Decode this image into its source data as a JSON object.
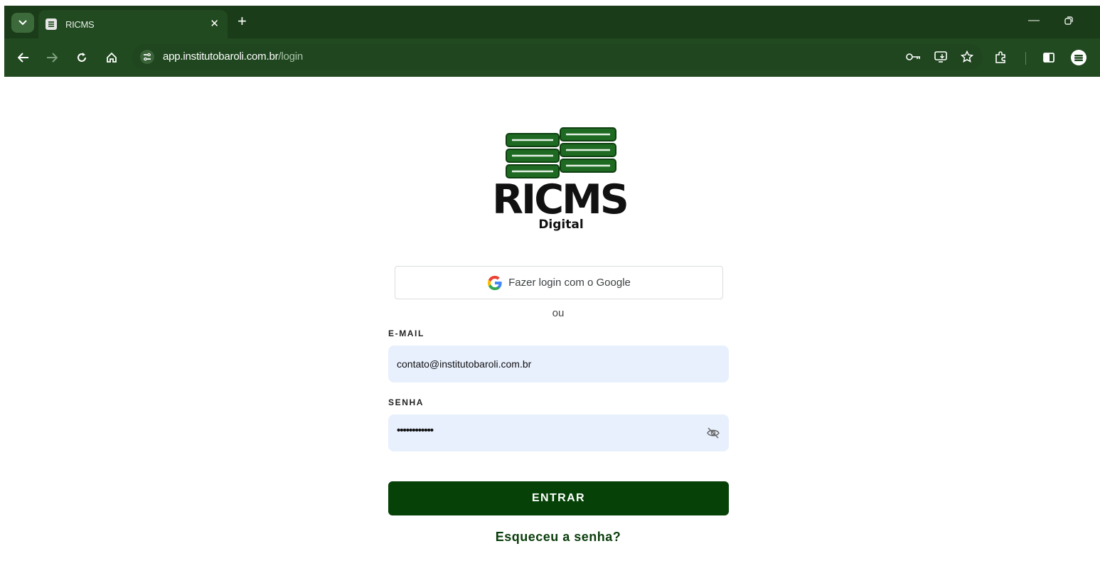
{
  "browser": {
    "tab": {
      "title": "RICMS"
    },
    "address_bar": {
      "host": "app.institutobaroli.com.br",
      "path": "/login"
    }
  },
  "colors": {
    "chrome_dark": "#1b3c19",
    "chrome": "#214a20",
    "brand_green": "#064207",
    "input_bg": "#e8f0fe"
  },
  "icons": [
    "tab-search-icon",
    "favicon-icon",
    "close-icon",
    "new-tab-icon",
    "minimize-icon",
    "restore-icon",
    "back-arrow-icon",
    "forward-arrow-icon",
    "reload-icon",
    "home-icon",
    "site-info-icon",
    "password-key-icon",
    "install-app-icon",
    "star-icon",
    "extensions-icon",
    "side-panel-icon",
    "profile-avatar-icon",
    "google-g-icon",
    "eye-off-icon"
  ],
  "logo": {
    "title": "RICMS",
    "subtitle": "Digital"
  },
  "login": {
    "google_button": "Fazer login com o Google",
    "separator": "ou",
    "email_label": "E-MAIL",
    "email_value": "contato@institutobaroli.com.br",
    "password_label": "SENHA",
    "password_mask": "••••••••••••",
    "submit_label": "ENTRAR",
    "forgot_link": "Esqueceu a senha?"
  }
}
